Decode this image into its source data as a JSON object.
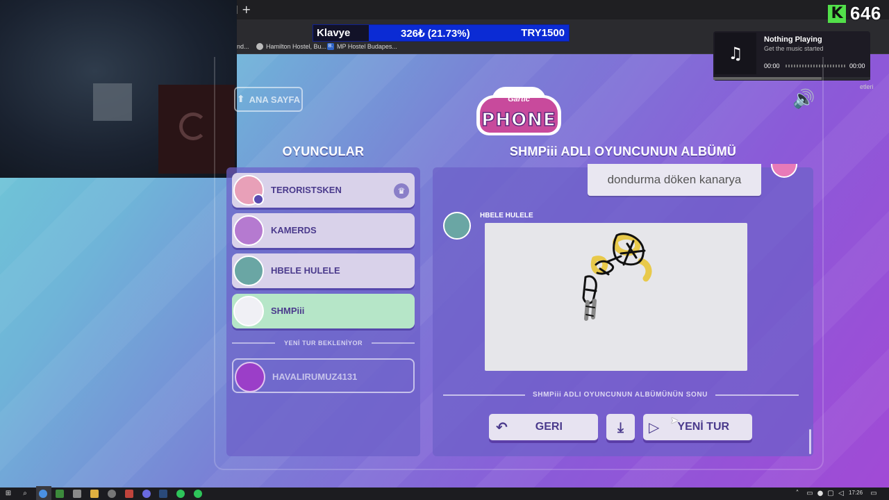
{
  "browser": {
    "new_tab_symbol": "+",
    "bookmarks": [
      "nd...",
      "Hamilton Hostel, Bu...",
      "MP Hostel Budapes..."
    ],
    "bookmark_mp_badge": "B.",
    "bookmark_right": "etleri"
  },
  "overlay": {
    "klavye_label": "Klavye",
    "klavye_value": "326₺ (21.73%)",
    "klavye_goal": "TRY1500",
    "kick_logo": "K",
    "kick_count": "646",
    "now_playing": {
      "title": "Nothing Playing",
      "subtitle": "Get the music started",
      "time_elapsed": "00:00",
      "time_total": "00:00",
      "icon": "music-note-icon",
      "progress": 0.69
    }
  },
  "game": {
    "home_button": "ANA SAYFA",
    "logo_top": "Gartic",
    "logo_main": "PHONE",
    "players_title": "OYUNCULAR",
    "album_title": "SHMPiii ADLI OYUNCUNUN ALBÜMÜ",
    "players": [
      {
        "name": "TERORISTSKEN",
        "host": true,
        "state": "normal"
      },
      {
        "name": "KAMERDS",
        "host": false,
        "state": "normal"
      },
      {
        "name": "HBELE HULELE",
        "host": false,
        "state": "normal"
      },
      {
        "name": "SHMPiii",
        "host": false,
        "state": "active"
      }
    ],
    "waiting_label": "YENİ TUR BEKLENİYOR",
    "waiting_players": [
      {
        "name": "HAVALIRUMUZ4131"
      }
    ],
    "album": {
      "prev_text": "dondurma döken kanarya",
      "author": "HBELE HULELE",
      "end_label": "SHMPiii ADLI OYUNCUNUN ALBÜMÜNÜN SONU"
    },
    "buttons": {
      "back": "GERI",
      "new_round": "YENİ TUR"
    }
  },
  "taskbar": {
    "clock": "17:26"
  },
  "colors": {
    "accent": "#4a3a8c",
    "active_player": "#b6e6c8",
    "panel": "#6c60c8"
  }
}
